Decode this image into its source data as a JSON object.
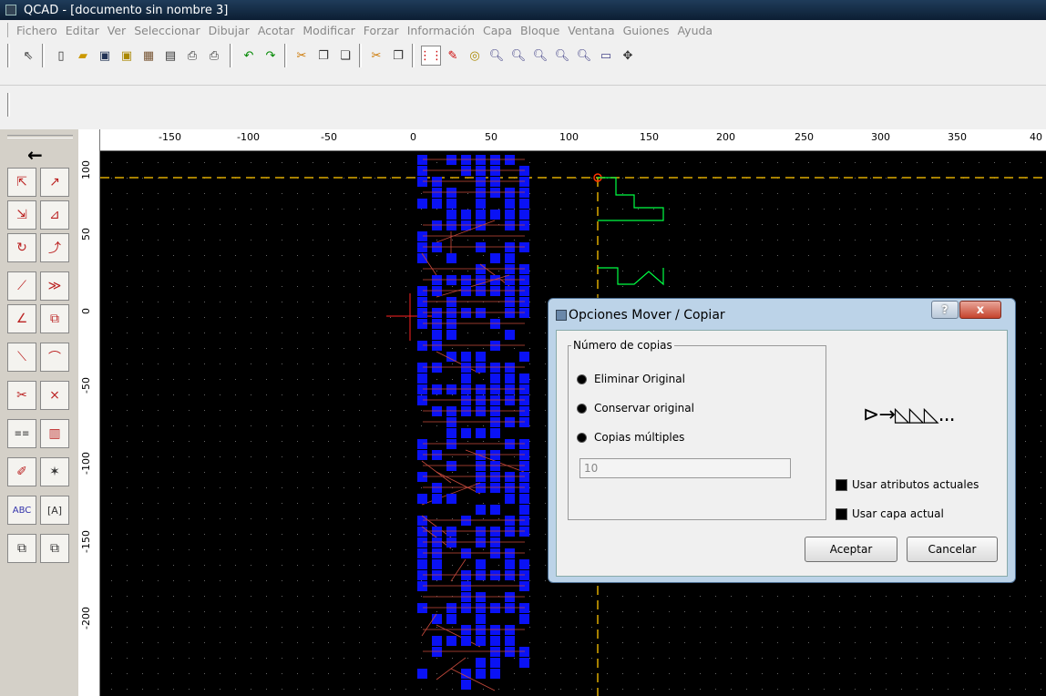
{
  "window": {
    "title": "QCAD - [documento sin nombre 3]"
  },
  "menu": [
    "Fichero",
    "Editar",
    "Ver",
    "Seleccionar",
    "Dibujar",
    "Acotar",
    "Modificar",
    "Forzar",
    "Información",
    "Capa",
    "Bloque",
    "Ventana",
    "Guiones",
    "Ayuda"
  ],
  "toolbar": {
    "icons": [
      "select-arrow-icon",
      "new-file-icon",
      "open-file-icon",
      "save-icon",
      "save-as-icon",
      "export-icon",
      "print-preview-icon",
      "print-icon",
      "print-setup-icon",
      "undo-icon",
      "redo-icon",
      "cut-icon",
      "copy-icon",
      "paste-icon",
      "cut-with-reference-icon",
      "copy-with-reference-icon",
      "grid-icon",
      "draft-icon",
      "redraw-icon",
      "zoom-in-icon",
      "zoom-out-icon",
      "zoom-auto-icon",
      "zoom-previous-icon",
      "zoom-window-icon",
      "zoom-selection-icon",
      "pan-icon"
    ]
  },
  "ruler": {
    "h": [
      "-150",
      "-100",
      "-50",
      "0",
      "50",
      "100",
      "150",
      "200",
      "250",
      "300",
      "350",
      "40"
    ],
    "v": [
      "100",
      "50",
      "0",
      "-50",
      "-100",
      "-150",
      "-200"
    ]
  },
  "leftpanel": {
    "back_arrow": "←",
    "tools": [
      "move-icon",
      "rotate-icon",
      "scale-icon",
      "mirror-icon",
      "move-rotate-icon",
      "rotate2-icon",
      "trim-icon",
      "trim2-icon",
      "lengthen-icon",
      "stretch-icon",
      "bevel-icon",
      "round-icon",
      "divide-icon",
      "divide2-icon",
      "attributes-icon",
      "properties-icon",
      "delete-icon",
      "explode-icon",
      "text-edit-icon",
      "text-explode-icon",
      "to-front-icon",
      "to-back-icon"
    ]
  },
  "dialog": {
    "title": "Opciones Mover / Copiar",
    "help_label": "?",
    "close_label": "x",
    "group_title": "Número de copias",
    "radios": [
      "Eliminar Original",
      "Conservar original",
      "Copias múltiples"
    ],
    "copies_value": "10",
    "checks": [
      "Usar atributos actuales",
      "Usar capa actual"
    ],
    "preview_glyph": "⊳→◺◺◺...",
    "ok_label": "Aceptar",
    "cancel_label": "Cancelar"
  },
  "colors": {
    "canvas": "#000000",
    "grid_dot": "#666666",
    "entity_blue": "#0a12f5",
    "entity_red": "#c84a3c",
    "entity_green": "#00ff44",
    "crosshair_yellow": "#ddaa00"
  }
}
